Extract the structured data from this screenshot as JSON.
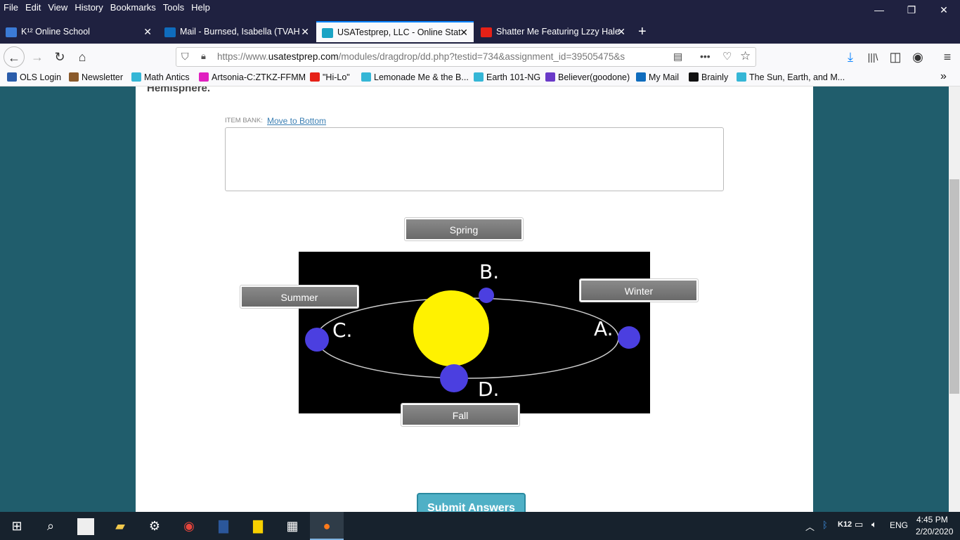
{
  "menu": [
    "File",
    "Edit",
    "View",
    "History",
    "Bookmarks",
    "Tools",
    "Help"
  ],
  "tabs": [
    {
      "label": "K¹² Online School",
      "color": "#3b7bd6"
    },
    {
      "label": "Mail - Burnsed, Isabella (TVAH",
      "color": "#0f6cbd"
    },
    {
      "label": "USATestprep, LLC - Online Stat",
      "color": "#1aa3c4"
    },
    {
      "label": "Shatter Me Featuring Lzzy Hale",
      "color": "#e62117"
    }
  ],
  "url": {
    "prefix": "https://www.",
    "domain": "usatestprep.com",
    "path": "/modules/dragdrop/dd.php?testid=734&assignment_id=39505475&s"
  },
  "bookmarks": [
    {
      "label": "OLS Login",
      "color": "#2a5caa"
    },
    {
      "label": "Newsletter",
      "color": "#8a5a2b"
    },
    {
      "label": "Math Antics",
      "color": "#35b6d6"
    },
    {
      "label": "Artsonia-C:ZTKZ-FFMM",
      "color": "#e020c0"
    },
    {
      "label": "\"Hi-Lo\"",
      "color": "#e62117"
    },
    {
      "label": "Lemonade Me & the B...",
      "color": "#35b6d6"
    },
    {
      "label": "Earth 101-NG",
      "color": "#35b6d6"
    },
    {
      "label": "Believer(goodone)",
      "color": "#6a3ac8"
    },
    {
      "label": "My Mail",
      "color": "#0f6cbd"
    },
    {
      "label": "Brainly",
      "color": "#111111"
    },
    {
      "label": "The Sun, Earth, and M...",
      "color": "#35b6d6"
    }
  ],
  "page": {
    "heading_fragment": "Hemisphere.",
    "item_bank_label": "ITEM BANK:",
    "move_link": "Move to Bottom",
    "labels": {
      "spring": "Spring",
      "summer": "Summer",
      "winter": "Winter",
      "fall": "Fall"
    },
    "diagram_letters": {
      "a": "A.",
      "b": "B.",
      "c": "C.",
      "d": "D."
    },
    "submit": "Submit Answers"
  },
  "tray": {
    "k12": "K12",
    "lang": "ENG",
    "time": "4:45 PM",
    "date": "2/20/2020"
  }
}
